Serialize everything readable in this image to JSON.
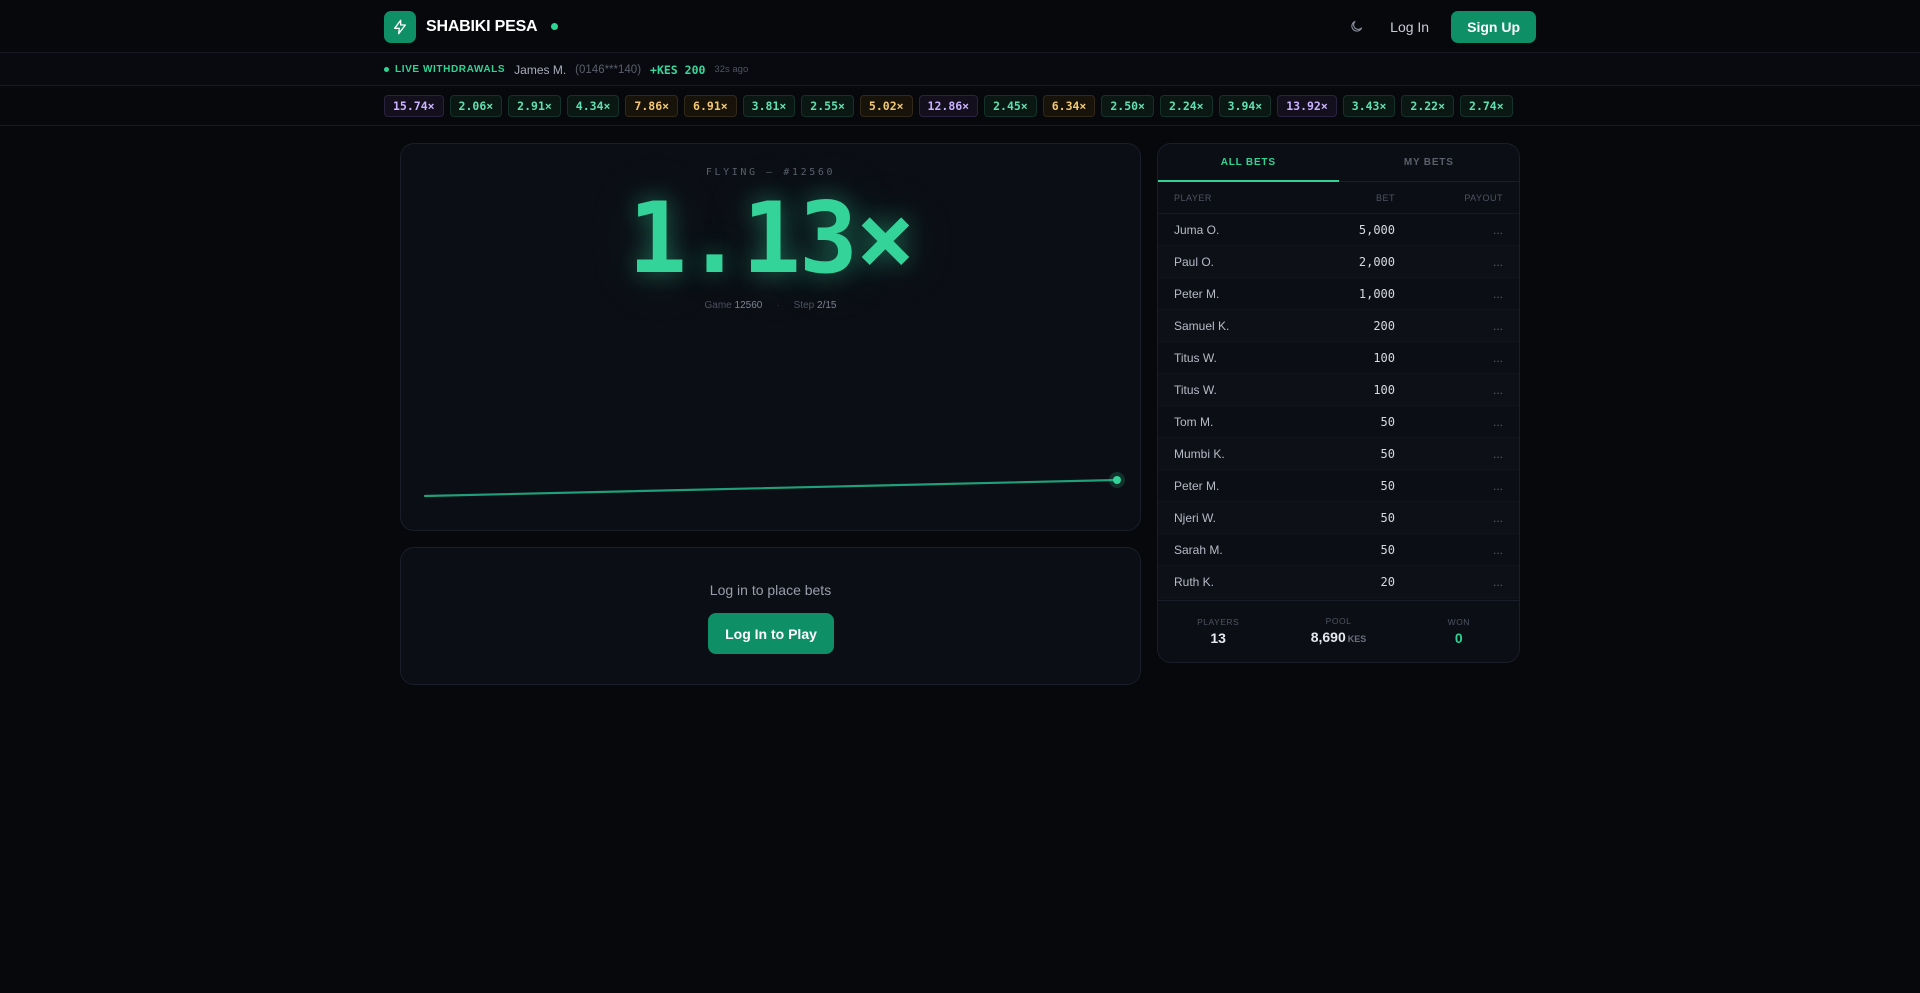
{
  "brand": {
    "name": "SHABIKI PESA"
  },
  "header": {
    "login_label": "Log In",
    "signup_label": "Sign Up"
  },
  "withdrawals": {
    "label": "LIVE WITHDRAWALS",
    "name": "James M.",
    "phone": "(0146***140)",
    "amount": "+KES 200",
    "time": "32s ago"
  },
  "history": [
    {
      "value": "15.74×",
      "tone": "purple"
    },
    {
      "value": "2.06×",
      "tone": "green"
    },
    {
      "value": "2.91×",
      "tone": "green"
    },
    {
      "value": "4.34×",
      "tone": "green"
    },
    {
      "value": "7.86×",
      "tone": "yellow"
    },
    {
      "value": "6.91×",
      "tone": "yellow"
    },
    {
      "value": "3.81×",
      "tone": "green"
    },
    {
      "value": "2.55×",
      "tone": "green"
    },
    {
      "value": "5.02×",
      "tone": "yellow"
    },
    {
      "value": "12.86×",
      "tone": "purple"
    },
    {
      "value": "2.45×",
      "tone": "green"
    },
    {
      "value": "6.34×",
      "tone": "yellow"
    },
    {
      "value": "2.50×",
      "tone": "green"
    },
    {
      "value": "2.24×",
      "tone": "green"
    },
    {
      "value": "3.94×",
      "tone": "green"
    },
    {
      "value": "13.92×",
      "tone": "purple"
    },
    {
      "value": "3.43×",
      "tone": "green"
    },
    {
      "value": "2.22×",
      "tone": "green"
    },
    {
      "value": "2.74×",
      "tone": "green"
    }
  ],
  "game": {
    "status": "FLYING — #12560",
    "multiplier": "1.13×",
    "game_label": "Game",
    "game_id": "12560",
    "step_label": "Step",
    "step": "2/15",
    "separator": "·"
  },
  "bet": {
    "prompt": "Log in to place bets",
    "play_label": "Log In to Play"
  },
  "bets": {
    "tabs": [
      {
        "label": "ALL BETS",
        "active": true
      },
      {
        "label": "MY BETS",
        "active": false
      }
    ],
    "columns": {
      "player": "PLAYER",
      "bet": "BET",
      "payout": "PAYOUT"
    },
    "rows": [
      {
        "player": "Juma O.",
        "bet": "5,000",
        "payout": "..."
      },
      {
        "player": "Paul O.",
        "bet": "2,000",
        "payout": "..."
      },
      {
        "player": "Peter M.",
        "bet": "1,000",
        "payout": "..."
      },
      {
        "player": "Samuel K.",
        "bet": "200",
        "payout": "..."
      },
      {
        "player": "Titus W.",
        "bet": "100",
        "payout": "..."
      },
      {
        "player": "Titus W.",
        "bet": "100",
        "payout": "..."
      },
      {
        "player": "Tom M.",
        "bet": "50",
        "payout": "..."
      },
      {
        "player": "Mumbi K.",
        "bet": "50",
        "payout": "..."
      },
      {
        "player": "Peter M.",
        "bet": "50",
        "payout": "..."
      },
      {
        "player": "Njeri W.",
        "bet": "50",
        "payout": "..."
      },
      {
        "player": "Sarah M.",
        "bet": "50",
        "payout": "..."
      },
      {
        "player": "Ruth K.",
        "bet": "20",
        "payout": "..."
      }
    ],
    "stats": {
      "players_label": "PLAYERS",
      "players": "13",
      "pool_label": "POOL",
      "pool": "8,690",
      "pool_unit": "KES",
      "won_label": "WON",
      "won": "0"
    }
  },
  "icons": {
    "logo": "lightning-icon",
    "theme": "moon-icon"
  },
  "colors": {
    "accent": "#0f8f66",
    "accent_light": "#2fd494",
    "background": "#07080c",
    "panel": "#0c0e15"
  }
}
